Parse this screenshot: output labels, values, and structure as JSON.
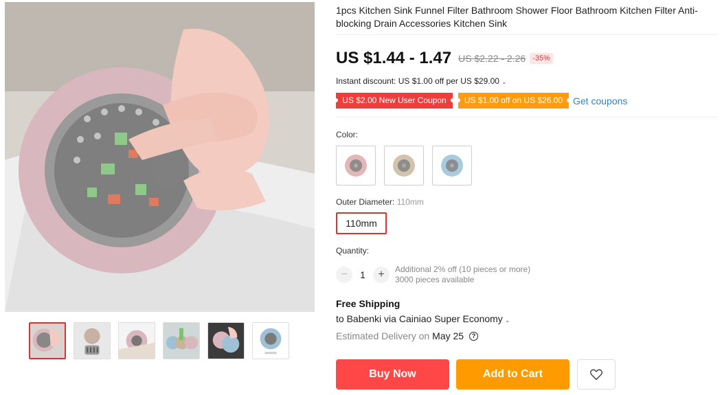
{
  "product": {
    "title": "1pcs Kitchen Sink Funnel Filter Bathroom Shower Floor Bathroom Kitchen Filter Anti-blocking Drain Accessories Kitchen Sink",
    "price": "US $1.44 - 1.47",
    "original_price": "US $2.22 - 2.26",
    "discount": "-35%"
  },
  "promo": {
    "instant_discount": "Instant discount: US $1.00 off per US $29.00",
    "coupon_1": "US $2.00 New User Coupon",
    "coupon_2": "US $1.00 off on US $26.00",
    "get_coupons": "Get coupons"
  },
  "options": {
    "color_label": "Color:",
    "colors": [
      "pink",
      "beige",
      "blue"
    ],
    "diameter_label": "Outer Diameter:",
    "diameter_selected": "110mm",
    "diameter_option": "110mm"
  },
  "quantity": {
    "label": "Quantity:",
    "value": "1",
    "minus": "−",
    "plus": "+",
    "note_1": "Additional 2% off (10 pieces or more)",
    "note_2": "3000 pieces available"
  },
  "shipping": {
    "title": "Free Shipping",
    "to": "to Babenki via Cainiao Super Economy",
    "estimated": "Estimated Delivery on",
    "date": "May 25",
    "help": "?"
  },
  "actions": {
    "buy_now": "Buy Now",
    "add_to_cart": "Add to Cart"
  },
  "colors_hex": {
    "accent_red": "#ff4747",
    "accent_orange": "#ff9b00",
    "link_blue": "#2b84c8"
  }
}
